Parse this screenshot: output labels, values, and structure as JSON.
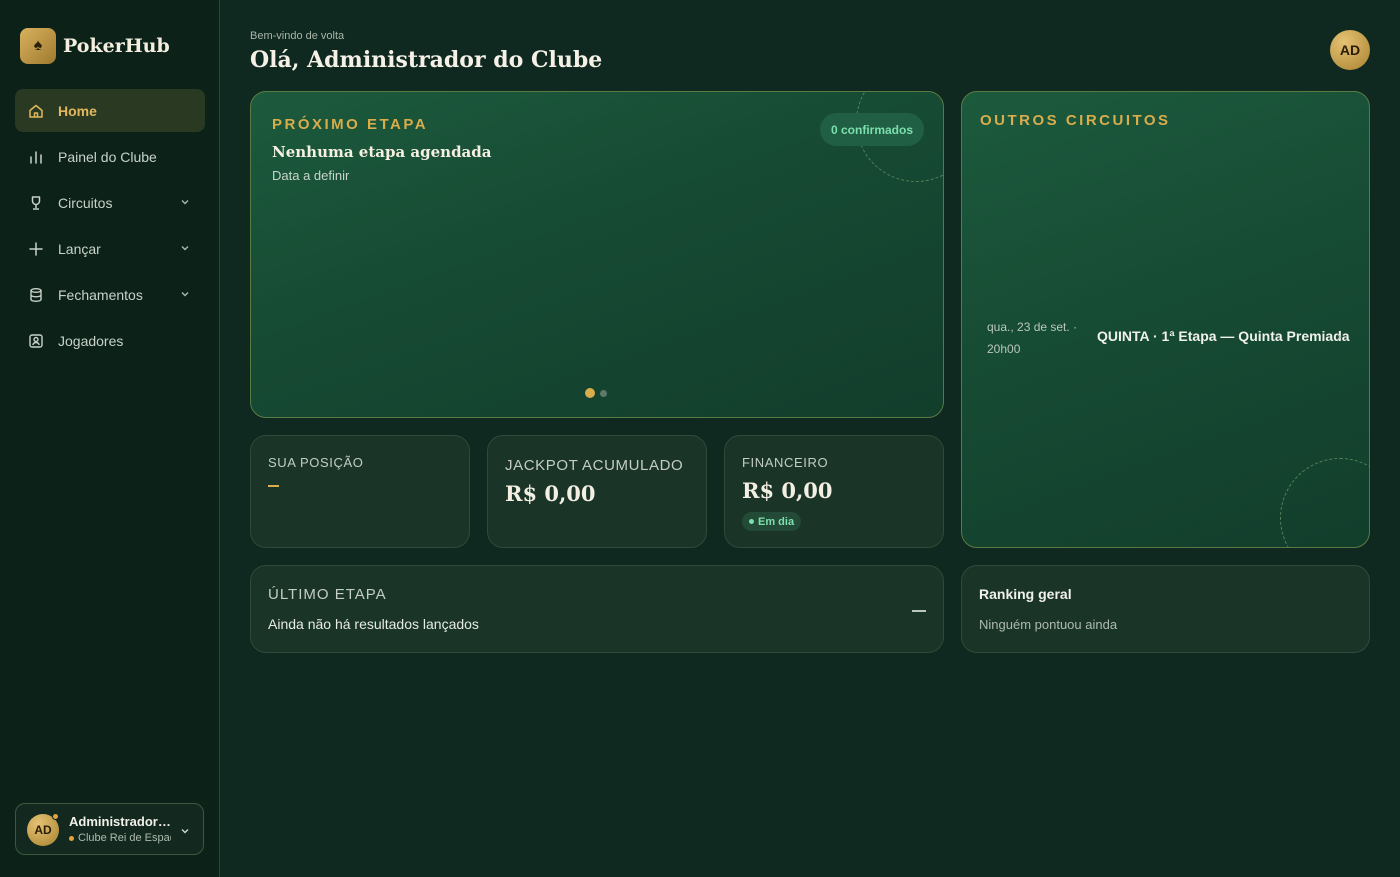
{
  "brand": {
    "name": "PokerHub",
    "logo_icon": "spade-icon"
  },
  "sidebar": {
    "items": [
      {
        "label": "Home",
        "icon": "home-icon",
        "active": true,
        "expandable": false
      },
      {
        "label": "Painel do Clube",
        "icon": "bar-chart-icon",
        "active": false,
        "expandable": false
      },
      {
        "label": "Circuitos",
        "icon": "trophy-icon",
        "active": false,
        "expandable": true
      },
      {
        "label": "Lançar",
        "icon": "plus-icon",
        "active": false,
        "expandable": true
      },
      {
        "label": "Fechamentos",
        "icon": "database-icon",
        "active": false,
        "expandable": true
      },
      {
        "label": "Jogadores",
        "icon": "user-badge-icon",
        "active": false,
        "expandable": false
      }
    ]
  },
  "user": {
    "initials": "AD",
    "name": "Administrador do Clube",
    "club": "Clube Rei de Espadas"
  },
  "header": {
    "welcome": "Bem-vindo de volta",
    "greeting": "Olá, Administrador do Clube",
    "avatar_initials": "AD"
  },
  "next_stage": {
    "eyebrow": "PRÓXIMO ETAPA",
    "confirmed": "0 confirmados",
    "title": "Nenhuma etapa agendada",
    "date": "Data a definir",
    "carousel_total": 2,
    "carousel_active": 1
  },
  "other_circuits": {
    "eyebrow": "OUTROS CIRCUITOS",
    "event_date": "qua., 23 de set. · 20h00",
    "event_title": "QUINTA · 1ª Etapa — Quinta Premiada"
  },
  "stats": {
    "position": {
      "label": "SUA POSIÇÃO"
    },
    "jackpot": {
      "label": "JACKPOT ACUMULADO",
      "value": "R$ 0,00"
    },
    "finance": {
      "label": "FINANCEIRO",
      "value": "R$ 0,00",
      "badge": "Em dia"
    }
  },
  "last_stage": {
    "title": "ÚLTIMO ETAPA",
    "text": "Ainda não há resultados lançados"
  },
  "ranking": {
    "title": "Ranking geral",
    "text": "Ninguém pontuou ainda"
  },
  "colors": {
    "accent_gold": "#d9ac4c",
    "success_green": "#7be0ad",
    "background": "#0f2820"
  }
}
